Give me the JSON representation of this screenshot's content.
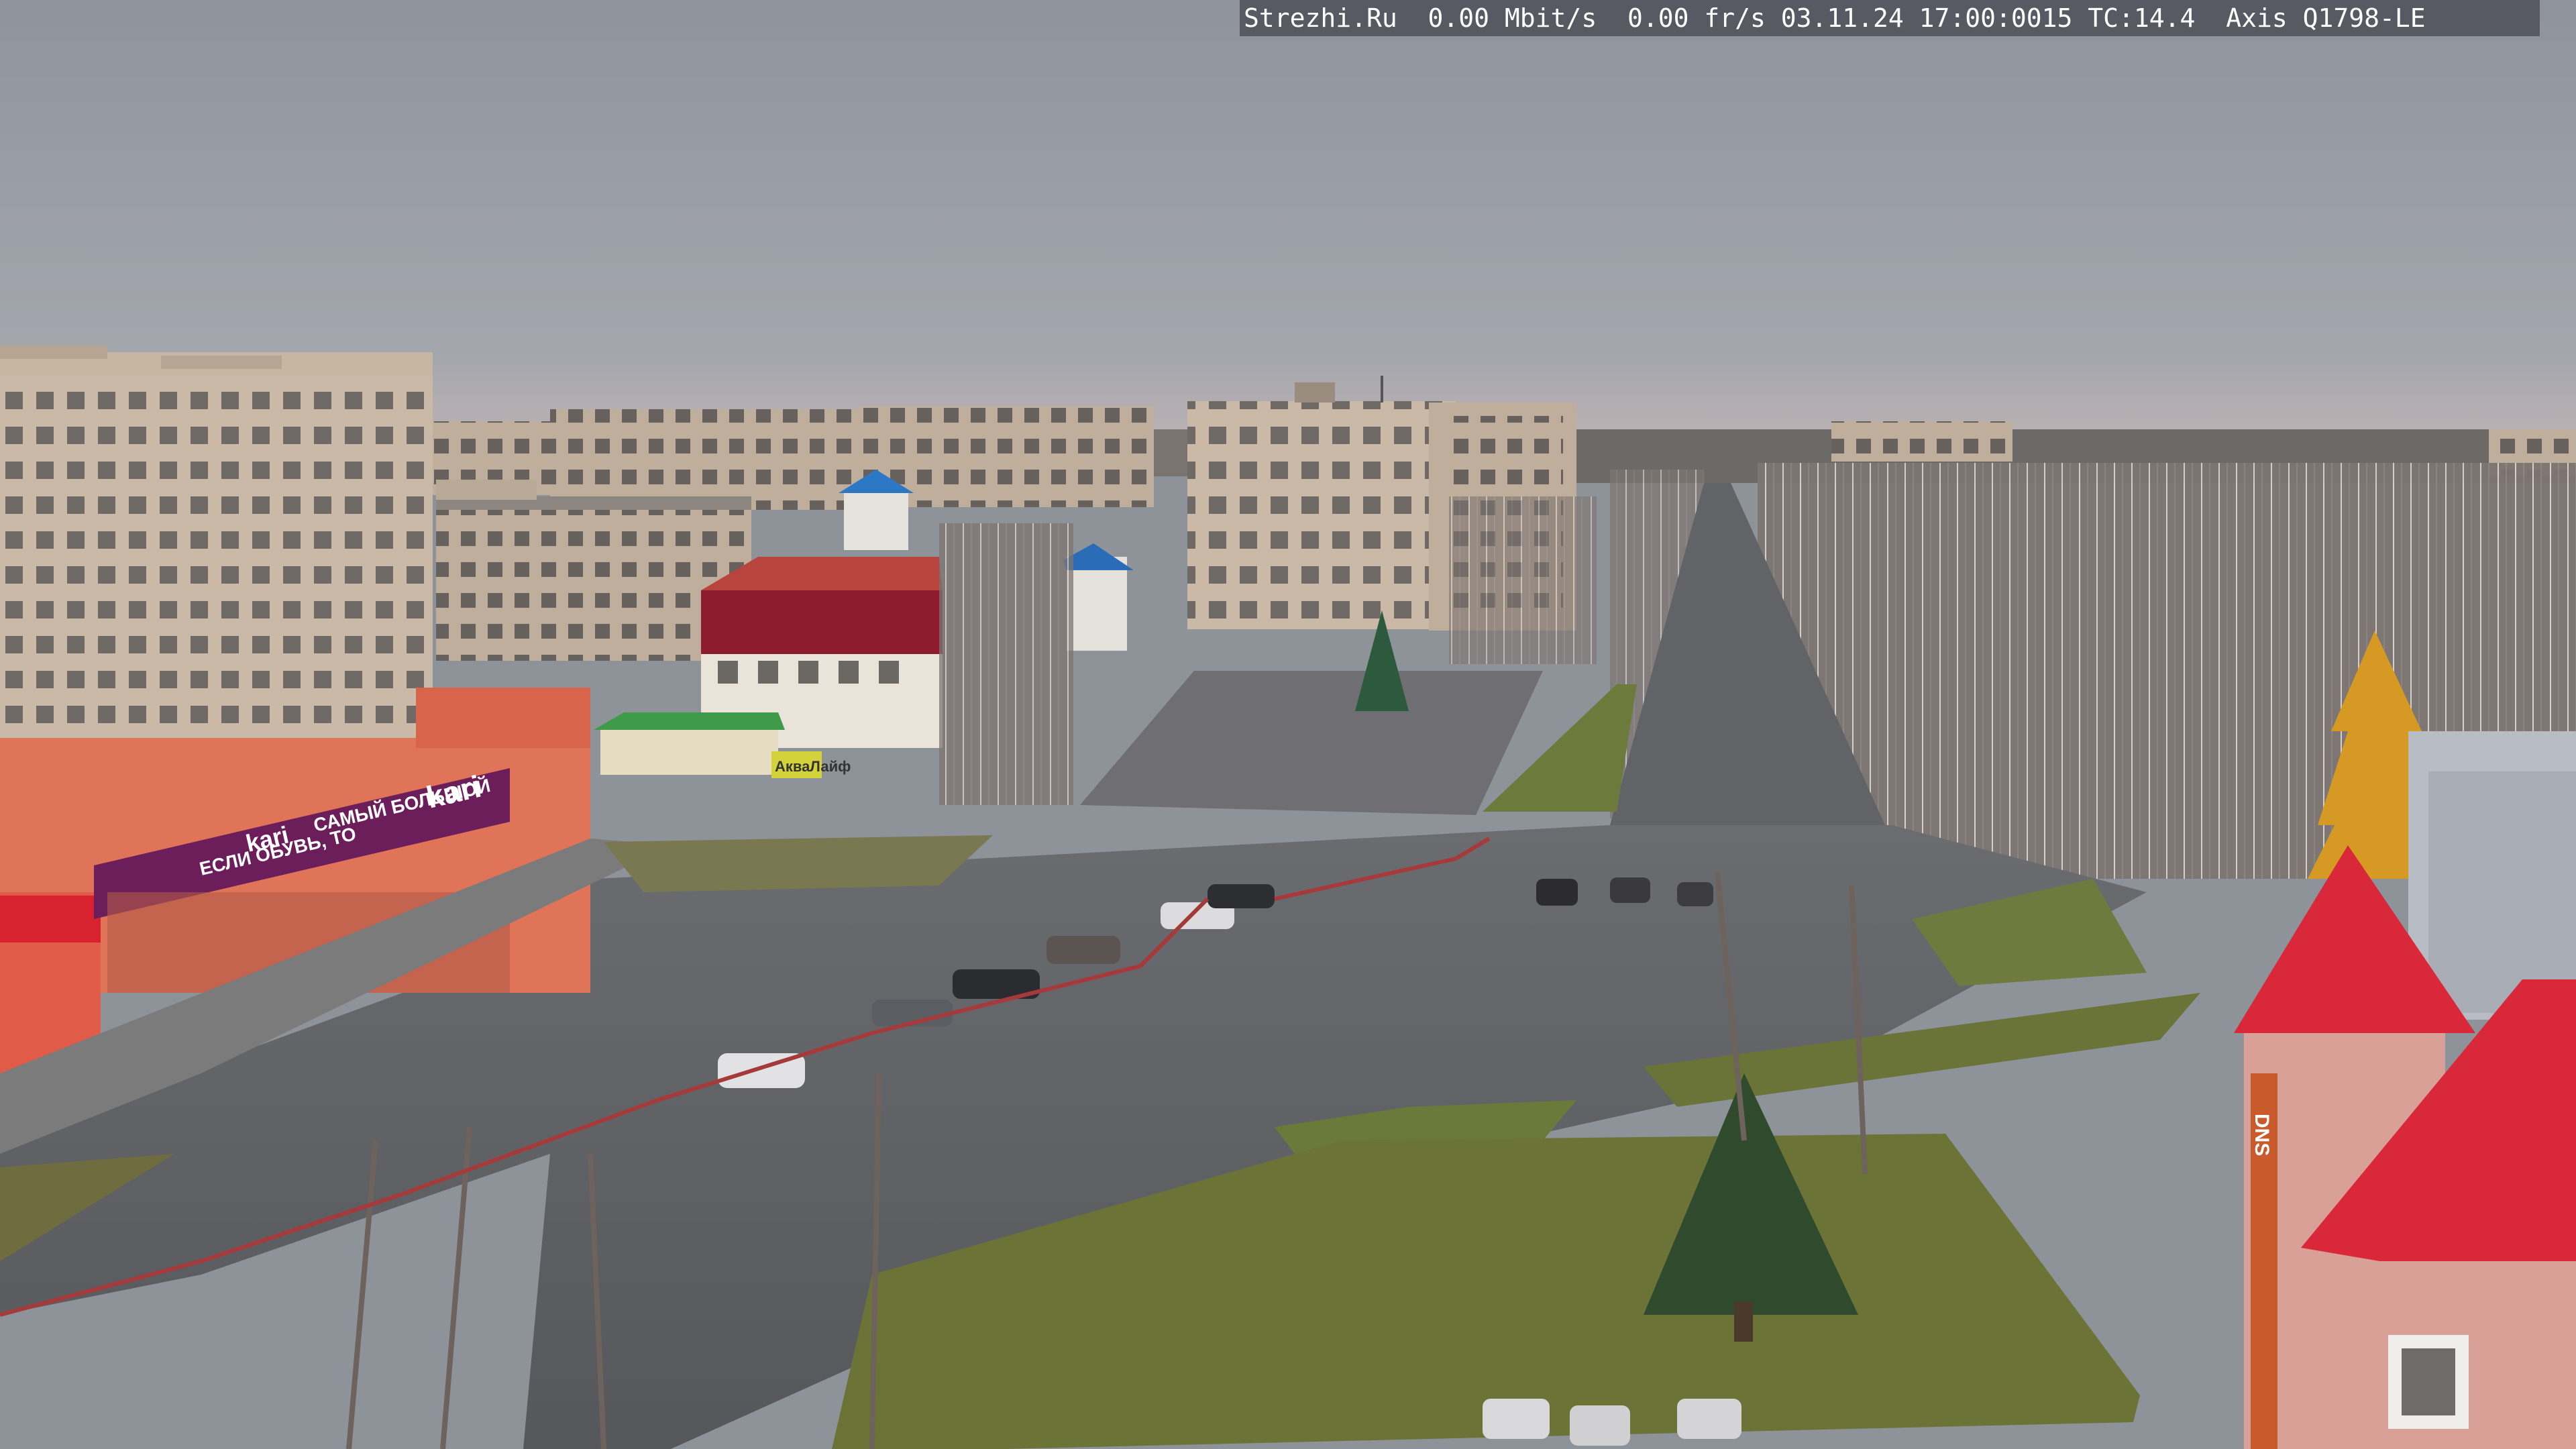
{
  "camera_overlay": {
    "text": "Strezhi.Ru  0.00 Mbit/s  0.00 fr/s 03.11.24 17:00:0015 TC:14.4  Axis Q1798-LE",
    "background": "#4e5058",
    "color": "#ffffff"
  },
  "signs": {
    "kari_logo": "kari",
    "kari_logo_small": "kari",
    "kari_banner_line1": "САМЫЙ БОЛЬШОЙ",
    "kari_banner_line2": "ЕСЛИ ОБУВЬ, ТО",
    "dns_vertical": "DNS",
    "green_store": "АкваЛайф"
  },
  "colors": {
    "sky": "#9a9ea6",
    "road": "#5e6064",
    "panel_building": "#c9b8a4",
    "red_roof": "#d8283a",
    "kari_facade": "#e07458",
    "kari_banner": "#6c1e5a",
    "grass": "#6e7a3e",
    "yellow_tree": "#d69a24"
  }
}
